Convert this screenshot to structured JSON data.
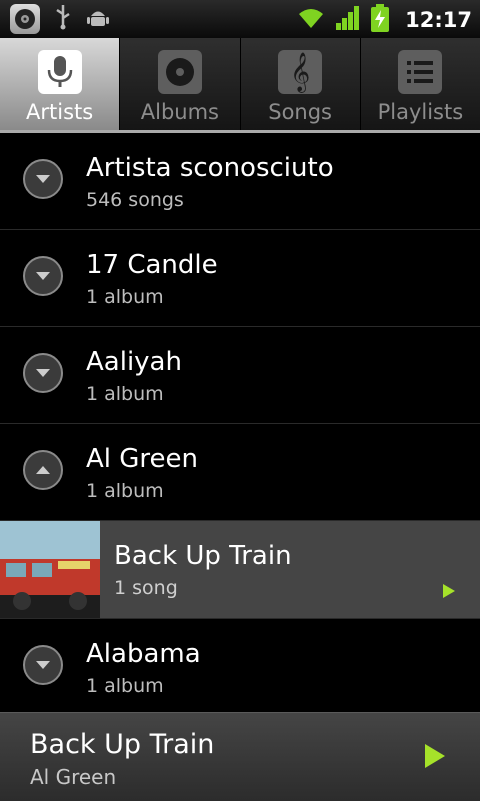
{
  "status_bar": {
    "time": "12:17",
    "icons": [
      "music-notification-icon",
      "usb-icon",
      "android-debug-icon",
      "wifi-icon",
      "signal-icon",
      "battery-charging-icon"
    ]
  },
  "tabs": [
    {
      "label": "Artists",
      "icon": "microphone-icon",
      "active": true
    },
    {
      "label": "Albums",
      "icon": "album-disc-icon",
      "active": false
    },
    {
      "label": "Songs",
      "icon": "treble-clef-icon",
      "active": false
    },
    {
      "label": "Playlists",
      "icon": "playlist-icon",
      "active": false
    }
  ],
  "artists": [
    {
      "name": "Artista sconosciuto",
      "count": "546 songs",
      "expanded": false
    },
    {
      "name": "17 Candle",
      "count": "1 album",
      "expanded": false
    },
    {
      "name": "Aaliyah",
      "count": "1 album",
      "expanded": false
    },
    {
      "name": "Al Green",
      "count": "1 album",
      "expanded": true
    }
  ],
  "expanded_album": {
    "title": "Back Up Train",
    "count": "1 song"
  },
  "artists_after": [
    {
      "name": "Alabama",
      "count": "1 album",
      "expanded": false
    }
  ],
  "now_playing": {
    "title": "Back Up Train",
    "artist": "Al Green"
  },
  "colors": {
    "accent_play": "#a6e22a",
    "active_tab_bg": "#c8c8c8"
  }
}
